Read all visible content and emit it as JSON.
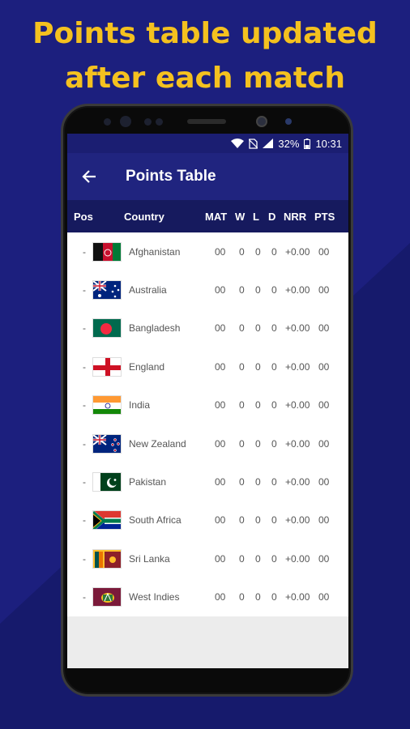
{
  "headline": {
    "line1": "Points table updated",
    "line2": "after each match"
  },
  "status": {
    "battery": "32%",
    "time": "10:31"
  },
  "appbar": {
    "title": "Points Table",
    "back_icon": "arrow-back-icon"
  },
  "table": {
    "columns": [
      "Pos",
      "Country",
      "MAT",
      "W",
      "L",
      "D",
      "NRR",
      "PTS"
    ],
    "rows": [
      {
        "pos": "-",
        "country": "Afghanistan",
        "mat": "00",
        "w": "0",
        "l": "0",
        "d": "0",
        "nrr": "+0.00",
        "pts": "00",
        "flag": "afghanistan-flag-icon"
      },
      {
        "pos": "-",
        "country": "Australia",
        "mat": "00",
        "w": "0",
        "l": "0",
        "d": "0",
        "nrr": "+0.00",
        "pts": "00",
        "flag": "australia-flag-icon"
      },
      {
        "pos": "-",
        "country": "Bangladesh",
        "mat": "00",
        "w": "0",
        "l": "0",
        "d": "0",
        "nrr": "+0.00",
        "pts": "00",
        "flag": "bangladesh-flag-icon"
      },
      {
        "pos": "-",
        "country": "England",
        "mat": "00",
        "w": "0",
        "l": "0",
        "d": "0",
        "nrr": "+0.00",
        "pts": "00",
        "flag": "england-flag-icon"
      },
      {
        "pos": "-",
        "country": "India",
        "mat": "00",
        "w": "0",
        "l": "0",
        "d": "0",
        "nrr": "+0.00",
        "pts": "00",
        "flag": "india-flag-icon"
      },
      {
        "pos": "-",
        "country": "New Zealand",
        "mat": "00",
        "w": "0",
        "l": "0",
        "d": "0",
        "nrr": "+0.00",
        "pts": "00",
        "flag": "new-zealand-flag-icon"
      },
      {
        "pos": "-",
        "country": "Pakistan",
        "mat": "00",
        "w": "0",
        "l": "0",
        "d": "0",
        "nrr": "+0.00",
        "pts": "00",
        "flag": "pakistan-flag-icon"
      },
      {
        "pos": "-",
        "country": "South Africa",
        "mat": "00",
        "w": "0",
        "l": "0",
        "d": "0",
        "nrr": "+0.00",
        "pts": "00",
        "flag": "south-africa-flag-icon"
      },
      {
        "pos": "-",
        "country": "Sri Lanka",
        "mat": "00",
        "w": "0",
        "l": "0",
        "d": "0",
        "nrr": "+0.00",
        "pts": "00",
        "flag": "sri-lanka-flag-icon"
      },
      {
        "pos": "-",
        "country": "West Indies",
        "mat": "00",
        "w": "0",
        "l": "0",
        "d": "0",
        "nrr": "+0.00",
        "pts": "00",
        "flag": "west-indies-flag-icon"
      }
    ]
  },
  "colors": {
    "background": "#1c1f7e",
    "headline": "#f4c11f",
    "appbar": "#20247f",
    "table_header": "#161a5e"
  }
}
